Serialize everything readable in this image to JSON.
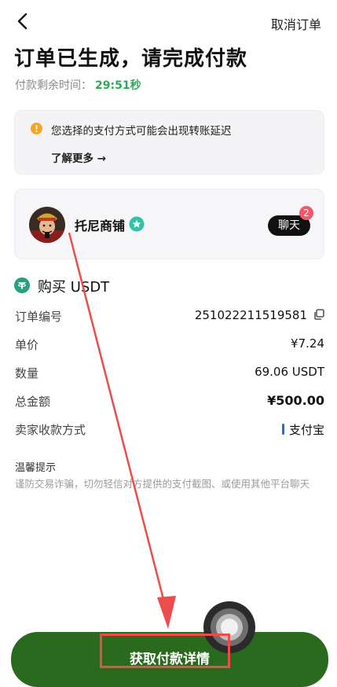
{
  "header": {
    "back_icon": "chevron-left-icon",
    "cancel_label": "取消订单",
    "title": "订单已生成，请完成付款",
    "timer_label": "付款剩余时间：",
    "timer_value": "29:51秒"
  },
  "notice": {
    "icon": "warning-icon",
    "text": "您选择的支付方式可能会出现转账延迟",
    "link_label": "了解更多 →"
  },
  "merchant": {
    "name": "托尼商铺",
    "chat_label": "聊天",
    "chat_badge": "2"
  },
  "order": {
    "heading": "购买 USDT",
    "rows": [
      {
        "label": "订单编号",
        "value": "251022211519581"
      },
      {
        "label": "单价",
        "value": "¥7.24"
      },
      {
        "label": "数量",
        "value": "69.06 USDT"
      },
      {
        "label": "总金额",
        "value": "¥500.00"
      },
      {
        "label": "卖家收款方式",
        "value": "支付宝"
      }
    ]
  },
  "tips": {
    "title": "温馨提示",
    "body": "谨防交易诈骗，切勿轻信对方提供的支付截图、或使用其他平台聊天"
  },
  "cta": {
    "label": "获取付款详情"
  },
  "colors": {
    "timer": "#2eaa57",
    "cta_bg": "#2a6a1e",
    "badge": "#f0596a",
    "annotation_red": "#ee4b4b",
    "tether_teal": "#26a17b"
  }
}
